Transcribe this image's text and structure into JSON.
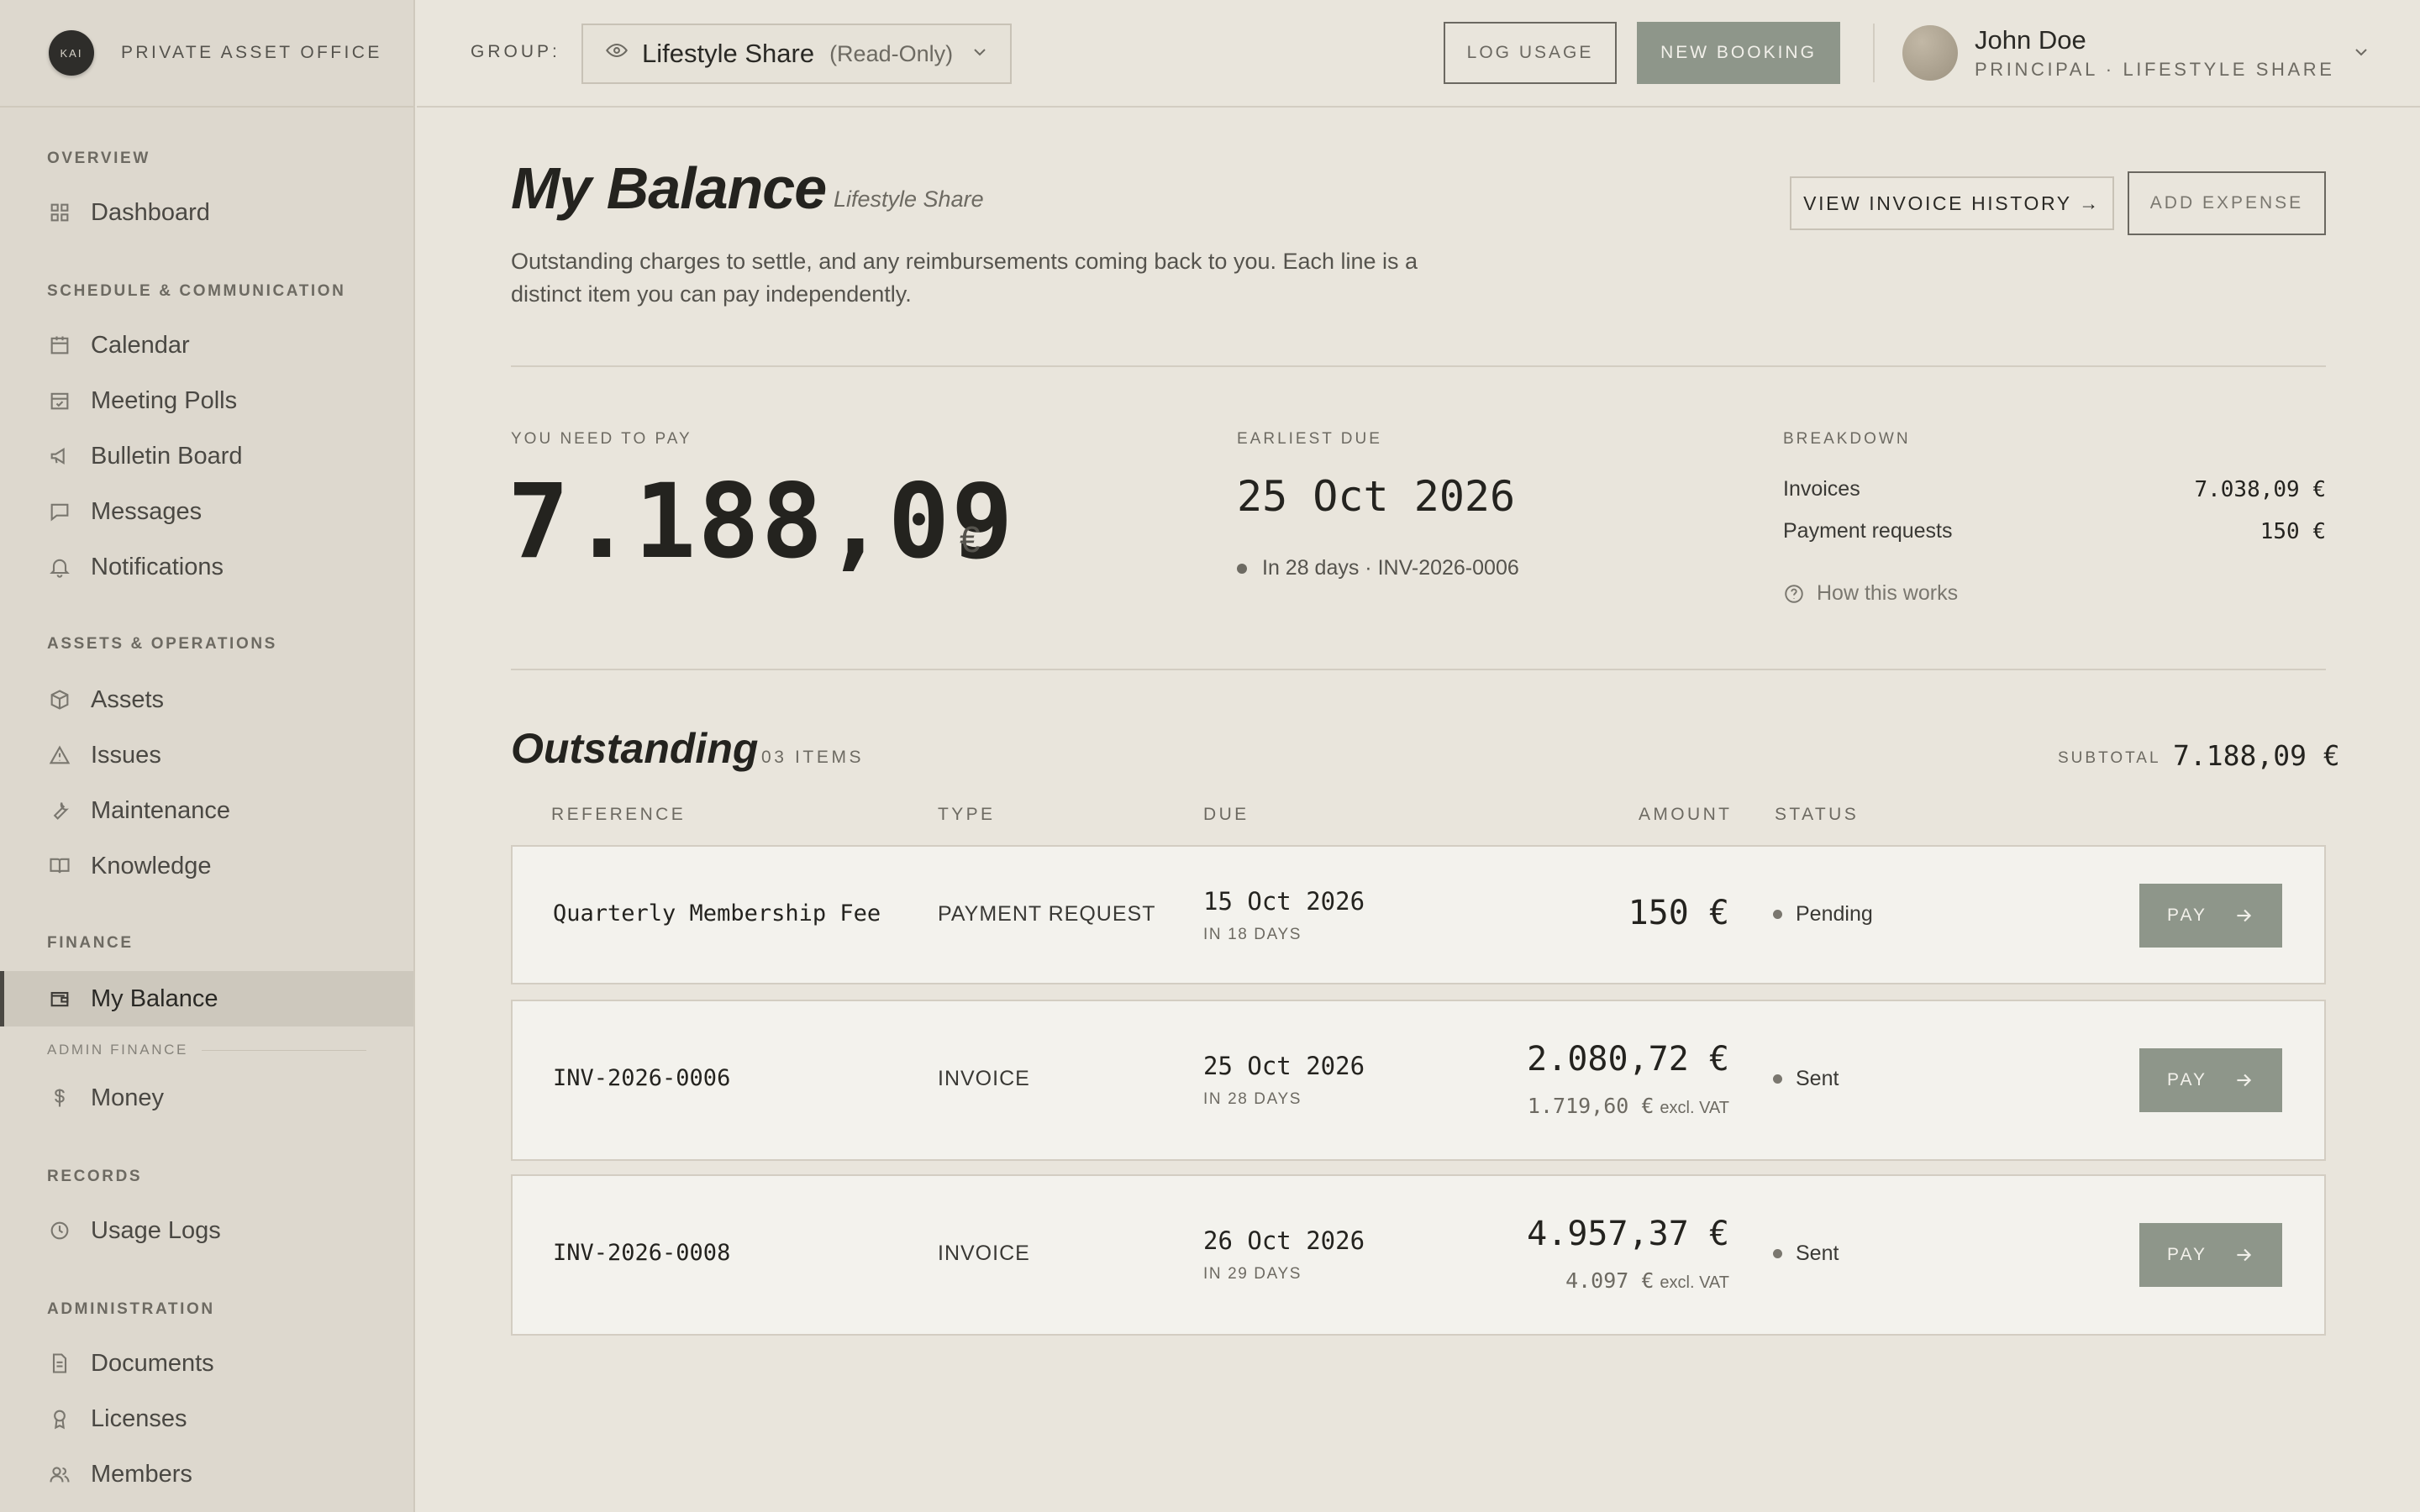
{
  "brand": {
    "logo_text": "KAI",
    "name": "PRIVATE ASSET OFFICE"
  },
  "sidebar": {
    "sections": [
      {
        "title": "OVERVIEW",
        "items": [
          {
            "label": "Dashboard",
            "icon": "grid-icon"
          }
        ]
      },
      {
        "title": "SCHEDULE & COMMUNICATION",
        "items": [
          {
            "label": "Calendar",
            "icon": "calendar-icon"
          },
          {
            "label": "Meeting Polls",
            "icon": "calendar-check-icon"
          },
          {
            "label": "Bulletin Board",
            "icon": "megaphone-icon"
          },
          {
            "label": "Messages",
            "icon": "message-icon"
          },
          {
            "label": "Notifications",
            "icon": "bell-icon"
          }
        ]
      },
      {
        "title": "ASSETS & OPERATIONS",
        "items": [
          {
            "label": "Assets",
            "icon": "box-icon"
          },
          {
            "label": "Issues",
            "icon": "warning-icon"
          },
          {
            "label": "Maintenance",
            "icon": "wrench-icon"
          },
          {
            "label": "Knowledge",
            "icon": "book-icon"
          }
        ]
      },
      {
        "title": "FINANCE",
        "items": [
          {
            "label": "My Balance",
            "icon": "wallet-icon",
            "active": true
          }
        ]
      },
      {
        "title": "RECORDS",
        "items": [
          {
            "label": "Usage Logs",
            "icon": "clock-icon"
          }
        ]
      },
      {
        "title": "ADMINISTRATION",
        "items": [
          {
            "label": "Documents",
            "icon": "document-icon"
          },
          {
            "label": "Licenses",
            "icon": "award-icon"
          },
          {
            "label": "Members",
            "icon": "users-icon"
          }
        ]
      }
    ],
    "admin_finance": {
      "title": "ADMIN FINANCE",
      "item": {
        "label": "Money",
        "icon": "dollar-icon"
      }
    }
  },
  "topbar": {
    "group_label": "GROUP:",
    "group_value": "Lifestyle Share",
    "group_mode": "(Read-Only)",
    "log_usage": "LOG USAGE",
    "new_booking": "NEW BOOKING",
    "user_name": "John Doe",
    "user_role": "PRINCIPAL · LIFESTYLE SHARE"
  },
  "page": {
    "title": "My Balance",
    "subtitle": "Lifestyle Share",
    "description": "Outstanding charges to settle, and any reimbursements coming back to you. Each line is a distinct item you can pay independently.",
    "view_history": "VIEW INVOICE HISTORY →",
    "add_expense": "ADD EXPENSE"
  },
  "summary": {
    "pay_label": "YOU NEED TO PAY",
    "pay_amount": "7.188,09",
    "pay_currency": "€",
    "due_label": "EARLIEST DUE",
    "due_date": "25 Oct 2026",
    "due_note": "In 28 days · INV-2026-0006",
    "breakdown_label": "BREAKDOWN",
    "breakdown": [
      {
        "label": "Invoices",
        "value": "7.038,09 €"
      },
      {
        "label": "Payment requests",
        "value": "150 €"
      }
    ],
    "how_link": "How this works"
  },
  "outstanding": {
    "title": "Outstanding",
    "count": "03 ITEMS",
    "subtotal_label": "SUBTOTAL",
    "subtotal_value": "7.188,09 €",
    "columns": {
      "reference": "REFERENCE",
      "type": "TYPE",
      "due": "DUE",
      "amount": "AMOUNT",
      "status": "STATUS"
    },
    "rows": [
      {
        "reference": "Quarterly Membership Fee",
        "type": "PAYMENT REQUEST",
        "due": "15 Oct 2026",
        "in": "IN 18 DAYS",
        "amount": "150 €",
        "excl": "",
        "excl_label": "",
        "status": "Pending",
        "pay": "PAY"
      },
      {
        "reference": "INV-2026-0006",
        "type": "INVOICE",
        "due": "25 Oct 2026",
        "in": "IN 28 DAYS",
        "amount": "2.080,72 €",
        "excl": "1.719,60 €",
        "excl_label": "excl. VAT",
        "status": "Sent",
        "pay": "PAY"
      },
      {
        "reference": "INV-2026-0008",
        "type": "INVOICE",
        "due": "26 Oct 2026",
        "in": "IN 29 DAYS",
        "amount": "4.957,37 €",
        "excl": "4.097 €",
        "excl_label": "excl. VAT",
        "status": "Sent",
        "pay": "PAY"
      }
    ]
  }
}
